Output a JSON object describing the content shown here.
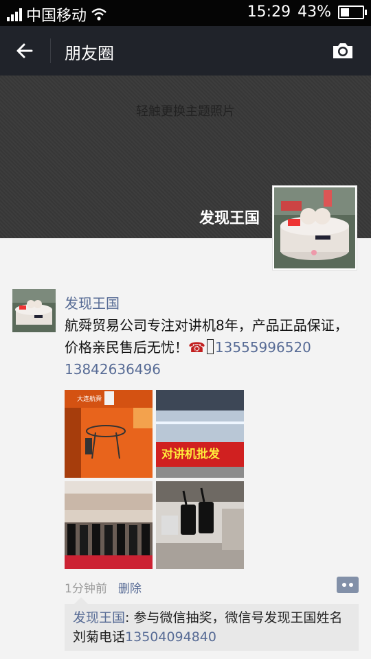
{
  "status_bar": {
    "carrier": "中国移动",
    "time": "15:29",
    "battery": "43%",
    "battery_level": 0.43
  },
  "nav": {
    "title": "朋友圈"
  },
  "cover": {
    "hint": "轻触更换主题照片",
    "name": "发现王国"
  },
  "post": {
    "author": "发现王国",
    "text_prefix": "航舜贸易公司专注对讲机8年，产品正品保证，价格亲民售后无忧！",
    "phone_emoji": "☎",
    "phones": "13555996520  13842636496",
    "photos": [
      {
        "sign_text": "大连航舜"
      },
      {
        "banner": "对讲机批发"
      },
      {},
      {}
    ],
    "time": "1分钟前",
    "delete_label": "删除",
    "comment": {
      "name": "发现王国",
      "text": ": 参与微信抽奖，微信号发现王国姓名刘菊电话",
      "phone": "13504094840"
    }
  },
  "colors": {
    "link": "#576b95",
    "nav_bg": "#20232a",
    "page_bg": "#f3f3f3"
  }
}
